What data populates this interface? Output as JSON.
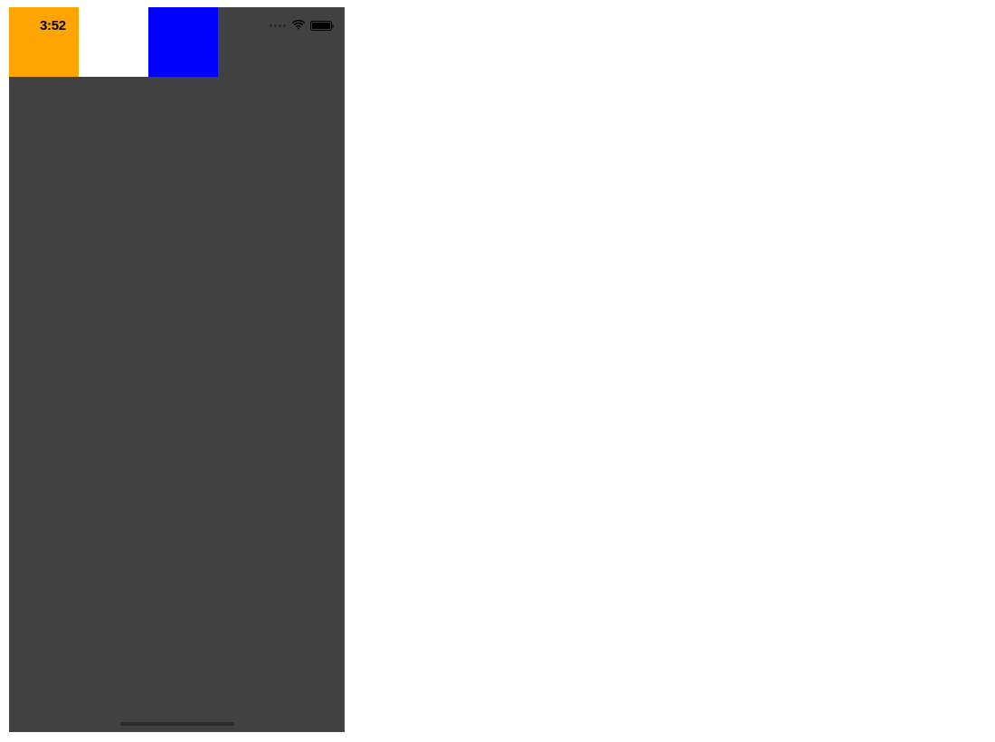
{
  "statusBar": {
    "time": "3:52"
  },
  "colors": {
    "deviceBackground": "#414141",
    "boxOrange": "#ffa500",
    "boxWhite": "#ffffff",
    "boxBlue": "#0000ff"
  }
}
